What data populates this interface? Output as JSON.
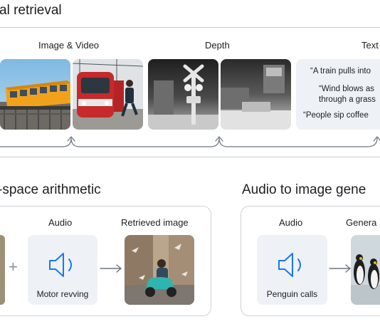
{
  "retrieval": {
    "title": "al retrieval",
    "columns": {
      "image_video": "Image & Video",
      "depth": "Depth",
      "text": "Text"
    },
    "text_samples": [
      "“A train pulls into",
      "“Wind blows as",
      "through a grass",
      "“People sip coffee"
    ]
  },
  "arithmetic": {
    "title": "-space arithmetic",
    "plus": "+",
    "audio_label": "Audio",
    "audio_caption": "Motor revving",
    "result_label": "Retrieved image"
  },
  "audio_to_image": {
    "title": "Audio to image gene",
    "audio_label": "Audio",
    "audio_caption": "Penguin calls",
    "result_label": "Genera"
  },
  "colors": {
    "accent": "#1877f2",
    "box": "#eef2f6",
    "rule": "#c9ccd1"
  },
  "icons": [
    "speaker-icon",
    "arrow-right-icon"
  ]
}
